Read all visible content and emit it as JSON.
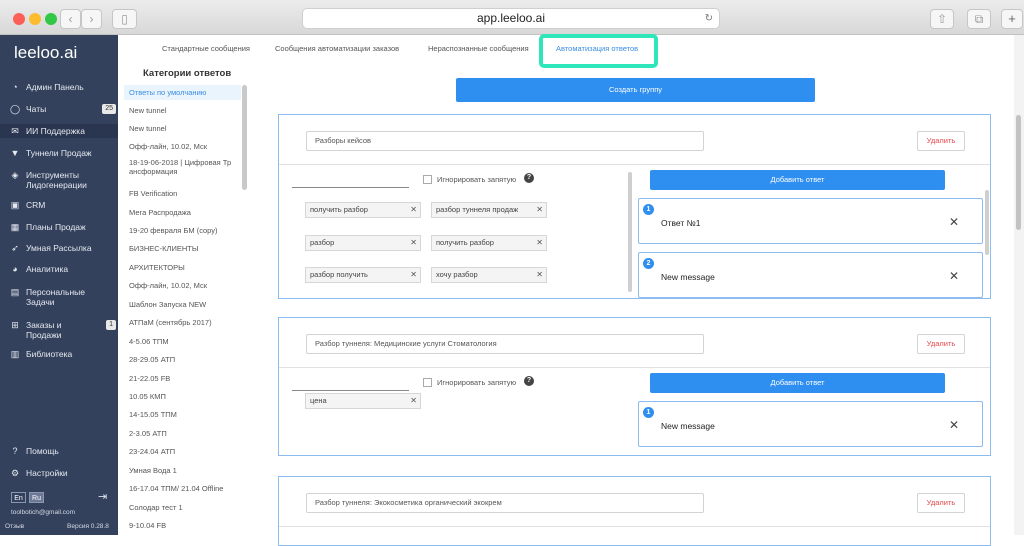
{
  "browser": {
    "url": "app.leeloo.ai",
    "new_tab": "+"
  },
  "sidebar": {
    "logo": "leeloo.ai",
    "items": [
      {
        "label": "Админ Панель",
        "icon": "dashboard-icon",
        "glyph": "◔"
      },
      {
        "label": "Чаты",
        "icon": "chat-icon",
        "glyph": "◯",
        "badge": "25"
      },
      {
        "label": "ИИ Поддержка",
        "icon": "mail-icon",
        "glyph": "✉"
      },
      {
        "label": "Туннели Продаж",
        "icon": "funnel-icon",
        "glyph": "▼"
      },
      {
        "label": "Инструменты\nЛидогенерации",
        "icon": "tag-icon",
        "glyph": "◈"
      },
      {
        "label": "CRM",
        "icon": "crm-icon",
        "glyph": "▣"
      },
      {
        "label": "Планы Продаж",
        "icon": "calendar-icon",
        "glyph": "▦"
      },
      {
        "label": "Умная Рассылка",
        "icon": "send-icon",
        "glyph": "➶"
      },
      {
        "label": "Аналитика",
        "icon": "pie-chart-icon",
        "glyph": "◕"
      },
      {
        "label": "Персональные\nЗадачи",
        "icon": "tasks-icon",
        "glyph": "▤"
      },
      {
        "label": "Заказы и\nПродажи",
        "icon": "cart-icon",
        "glyph": "⊞",
        "badge": "1"
      },
      {
        "label": "Библиотека",
        "icon": "book-icon",
        "glyph": "▥"
      }
    ],
    "help": "Помощь",
    "settings": "Настройки",
    "lang_en": "En",
    "lang_ru": "Ru",
    "email": "toolbotich@gmail.com",
    "feedback": "Отзыв",
    "version": "Версия 0.28.8"
  },
  "tabs": [
    "Стандартные сообщения",
    "Сообщения автоматизации заказов",
    "Нераспознанные сообщения",
    "Автоматизация ответов"
  ],
  "categories": {
    "title": "Категории ответов",
    "items": [
      "Ответы по умолчанию",
      "New tunnel",
      "New tunnel",
      "Офф-лайн, 10.02, Мск",
      "18-19-06-2018 | Цифровая Тр\nансформация",
      "FB Verification",
      "Мега Распродажа",
      "19-20 февраля БМ (copy)",
      "БИЗНЕС-КЛИЕНТЫ",
      "АРХИТЕКТОРЫ",
      "Офф-лайн, 10.02, Мск",
      "Шаблон Запуска NEW",
      "АТПаМ (сентябрь 2017)",
      "4-5.06 ТПМ",
      "28-29.05 АТП",
      "21-22.05 FB",
      "10.05 КМП",
      "14-15.05 ТПМ",
      "2-3.05 АТП",
      "23-24.04 АТП",
      "Умная Вода 1",
      "16-17.04 ТПМ/ 21.04 Offline",
      "Солодар тест 1",
      "9-10.04 FB"
    ]
  },
  "create_group": "Создать группу",
  "labels": {
    "ignore_comma": "Игнорировать запятую",
    "add_answer": "Добавить ответ",
    "delete": "Удалить",
    "help_mark": "?"
  },
  "groups": [
    {
      "name": "Разборы кейсов",
      "keywords": [
        "получить разбор",
        "разбор туннеля продаж",
        "разбор",
        "получить разбор",
        "разбор получить",
        "хочу разбор"
      ],
      "answers": [
        {
          "num": "1",
          "text": "Ответ №1"
        },
        {
          "num": "2",
          "text": "New message"
        }
      ]
    },
    {
      "name": "Разбор туннеля: Медицинские услуги Стоматология",
      "keywords": [
        "цена"
      ],
      "answers": [
        {
          "num": "1",
          "text": "New message"
        }
      ]
    },
    {
      "name": "Разбор туннеля: Экокосметика органический экокрем",
      "keywords": [],
      "answers": []
    }
  ],
  "colors": {
    "accent": "#2f8ff0",
    "sidebar": "#33415c",
    "highlight": "#2ee6b9",
    "danger": "#e5484d"
  }
}
